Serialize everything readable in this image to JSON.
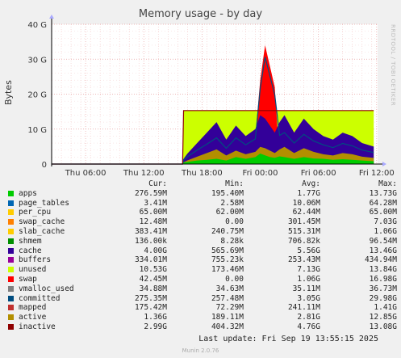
{
  "chart_data": {
    "type": "area",
    "title": "Memory usage - by day",
    "ylabel": "Bytes",
    "ylim": [
      0,
      40
    ],
    "y_unit": "G",
    "y_ticks": [
      "0",
      "10 G",
      "20 G",
      "30 G",
      "40 G"
    ],
    "x_ticks": [
      "Thu 06:00",
      "Thu 12:00",
      "Thu 18:00",
      "Fri 00:00",
      "Fri 06:00",
      "Fri 12:00"
    ],
    "x_range_hours": [
      0,
      33.6
    ],
    "grid": true,
    "series_samples": {
      "hours": [
        0,
        13.5,
        13.6,
        14,
        15,
        16,
        17,
        18,
        19,
        20,
        21,
        21.5,
        22,
        22.5,
        23,
        23.5,
        24,
        25,
        26,
        27,
        28,
        29,
        30,
        31,
        32,
        33.2
      ],
      "unused": [
        0,
        0,
        15.3,
        15.3,
        15.3,
        15.3,
        15.3,
        15.3,
        15.3,
        15.3,
        15.3,
        15.3,
        15.3,
        15.3,
        15.3,
        15.3,
        15.3,
        15.3,
        15.3,
        15.3,
        15.3,
        15.3,
        15.3,
        15.3,
        15.3,
        15.3
      ],
      "cache": [
        0,
        0,
        1.5,
        3,
        6,
        9,
        12,
        7,
        11,
        8,
        10,
        14,
        13,
        11,
        9,
        12,
        14,
        9,
        13,
        10,
        8,
        7,
        9,
        8,
        6,
        5
      ],
      "swap": [
        0,
        0,
        0,
        0,
        0,
        0,
        0,
        0,
        0,
        0,
        8,
        24,
        34,
        28,
        22,
        0,
        0,
        0,
        0,
        0,
        0,
        0,
        0,
        0,
        0,
        0
      ],
      "apps": [
        0,
        0,
        0.5,
        0.6,
        1,
        1.2,
        1.5,
        1,
        2,
        1.5,
        2,
        3,
        2.5,
        2,
        1.8,
        2.2,
        2,
        1.5,
        2,
        1.6,
        1.5,
        1.2,
        1.4,
        1.2,
        1,
        0.8
      ]
    },
    "legend": {
      "headers": [
        "Cur:",
        "Min:",
        "Avg:",
        "Max:"
      ],
      "rows": [
        {
          "name": "apps",
          "color": "#00cc00",
          "cur": "276.59M",
          "min": "195.40M",
          "avg": "1.77G",
          "max": "13.73G"
        },
        {
          "name": "page_tables",
          "color": "#0066b3",
          "cur": "3.41M",
          "min": "2.58M",
          "avg": "10.06M",
          "max": "64.28M"
        },
        {
          "name": "per_cpu",
          "color": "#ffcc00",
          "cur": "65.00M",
          "min": "62.00M",
          "avg": "62.44M",
          "max": "65.00M"
        },
        {
          "name": "swap_cache",
          "color": "#ff8000",
          "cur": "12.48M",
          "min": "0.00",
          "avg": "301.45M",
          "max": "7.03G"
        },
        {
          "name": "slab_cache",
          "color": "#ffcc00",
          "cur": "383.41M",
          "min": "240.75M",
          "avg": "515.31M",
          "max": "1.06G"
        },
        {
          "name": "shmem",
          "color": "#008f00",
          "cur": "136.00k",
          "min": "8.28k",
          "avg": "706.82k",
          "max": "96.54M"
        },
        {
          "name": "cache",
          "color": "#330099",
          "cur": "4.00G",
          "min": "565.69M",
          "avg": "5.56G",
          "max": "13.46G"
        },
        {
          "name": "buffers",
          "color": "#990099",
          "cur": "334.01M",
          "min": "755.23k",
          "avg": "253.43M",
          "max": "434.94M"
        },
        {
          "name": "unused",
          "color": "#ccff00",
          "cur": "10.53G",
          "min": "173.46M",
          "avg": "7.13G",
          "max": "13.84G"
        },
        {
          "name": "swap",
          "color": "#ff0000",
          "cur": "42.45M",
          "min": "0.00",
          "avg": "1.06G",
          "max": "16.98G"
        },
        {
          "name": "vmalloc_used",
          "color": "#808080",
          "cur": "34.88M",
          "min": "34.63M",
          "avg": "35.11M",
          "max": "36.73M"
        },
        {
          "name": "committed",
          "color": "#004d80",
          "cur": "275.35M",
          "min": "257.48M",
          "avg": "3.05G",
          "max": "29.98G"
        },
        {
          "name": "mapped",
          "color": "#c0312f",
          "cur": "175.42M",
          "min": "72.29M",
          "avg": "241.11M",
          "max": "1.41G"
        },
        {
          "name": "active",
          "color": "#b38f00",
          "cur": "1.36G",
          "min": "189.11M",
          "avg": "2.81G",
          "max": "12.85G"
        },
        {
          "name": "inactive",
          "color": "#8f0000",
          "cur": "2.99G",
          "min": "404.32M",
          "avg": "4.76G",
          "max": "13.08G"
        }
      ]
    }
  },
  "credit_text": "RRDTOOL / TOBI OETIKER",
  "last_update": "Last update:  Fri Sep 19 13:55:15 2025",
  "munin_version": "Munin 2.0.76"
}
